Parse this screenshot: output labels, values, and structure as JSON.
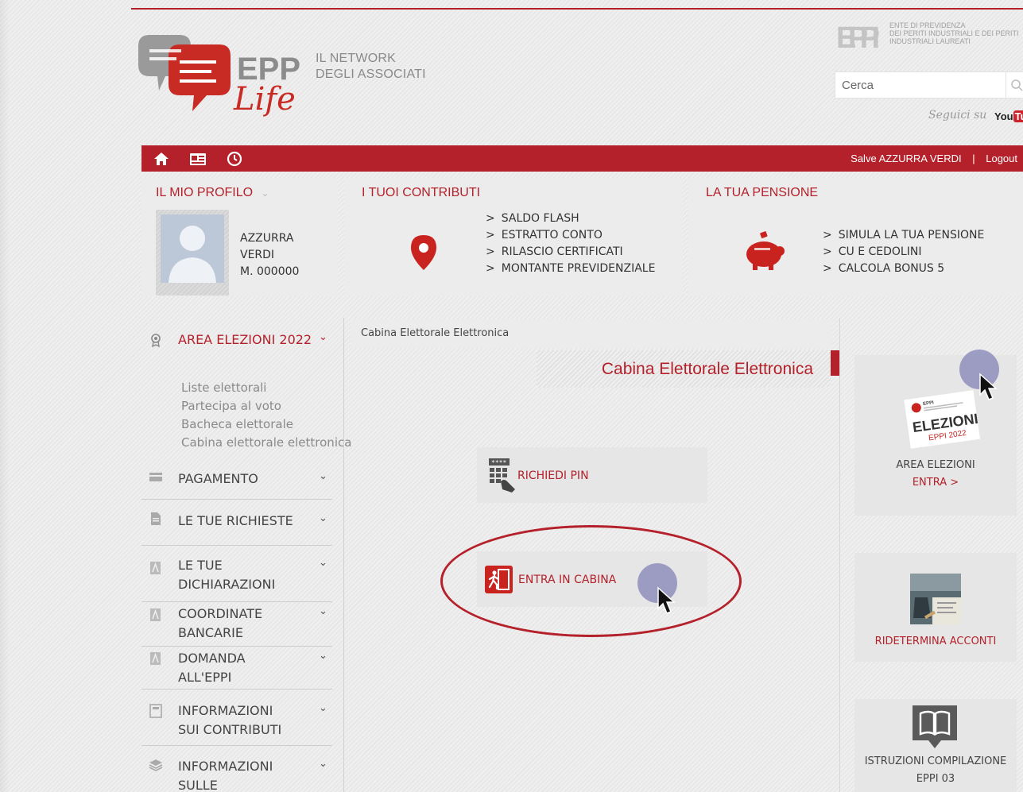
{
  "header": {
    "logo_wordmark": "EPPI",
    "logo_script": "Life",
    "tagline_line1": "IL NETWORK",
    "tagline_line2": "DEGLI ASSOCIATI",
    "eppi_mark": "EPPI",
    "eppi_subtitle": [
      "ENTE DI PREVIDENZA",
      "DEI PERITI INDUSTRIALI E DEI PERITI",
      "INDUSTRIALI LAUREATI"
    ],
    "search_placeholder": "Cerca",
    "follow_label": "Seguici su",
    "youtube_you": "You",
    "youtube_tube": "Tub"
  },
  "navbar": {
    "icons": [
      "home-icon",
      "id-card-icon",
      "clock-icon"
    ],
    "greeting": "Salve AZZURRA VERDI",
    "separator": "|",
    "logout": "Logout"
  },
  "profile": {
    "title": "IL MIO PROFILO",
    "first_name": "AZZURRA",
    "last_name": "VERDI",
    "member_id": "M. 000000"
  },
  "contributions": {
    "title": "I TUOI CONTRIBUTI",
    "links": [
      "SALDO FLASH",
      "ESTRATTO CONTO",
      "RILASCIO CERTIFICATI",
      "MONTANTE PREVIDENZIALE"
    ]
  },
  "pension": {
    "title": "LA TUA PENSIONE",
    "links": [
      "SIMULA LA TUA PENSIONE",
      "CU E CEDOLINI",
      "CALCOLA BONUS 5"
    ]
  },
  "link_prefix": ">",
  "sidebar": {
    "election": {
      "label": "AREA ELEZIONI 2022",
      "sub_items": [
        "Liste elettorali",
        "Partecipa al voto",
        "Bacheca elettorale",
        "Cabina elettorale elettronica"
      ]
    },
    "items": [
      {
        "label": "PAGAMENTO"
      },
      {
        "label": "LE TUE RICHIESTE"
      },
      {
        "label_l1": "LE TUE",
        "label_l2": "DICHIARAZIONI"
      },
      {
        "label_l1": "COORDINATE",
        "label_l2": "BANCARIE"
      },
      {
        "label_l1": "DOMANDA",
        "label_l2": "ALL'EPPI"
      },
      {
        "label_l1": "INFORMAZIONI",
        "label_l2": "SUI CONTRIBUTI"
      },
      {
        "label_l1": "INFORMAZIONI",
        "label_l2": "SULLE"
      }
    ],
    "chevron": "⌄"
  },
  "main": {
    "breadcrumb": "Cabina Elettorale Elettronica",
    "title": "Cabina Elettorale Elettronica",
    "pin_button": "RICHIEDI PIN",
    "cabin_button": "ENTRA IN CABINA"
  },
  "right_cards": {
    "elections": {
      "badge_top": "EPPI",
      "badge_title": "ELEZIONI",
      "badge_year": "EPPI 2022",
      "title": "AREA ELEZIONI",
      "link": "ENTRA >"
    },
    "advance": {
      "link": "RIDETERMINA ACCONTI"
    },
    "instructions": {
      "title": "ISTRUZIONI COMPILAZIONE",
      "subtitle": "EPPI 03"
    }
  },
  "colors": {
    "brand_red": "#b5212a",
    "panel_gray": "#ececec",
    "cursor_halo": "#8080b4"
  }
}
